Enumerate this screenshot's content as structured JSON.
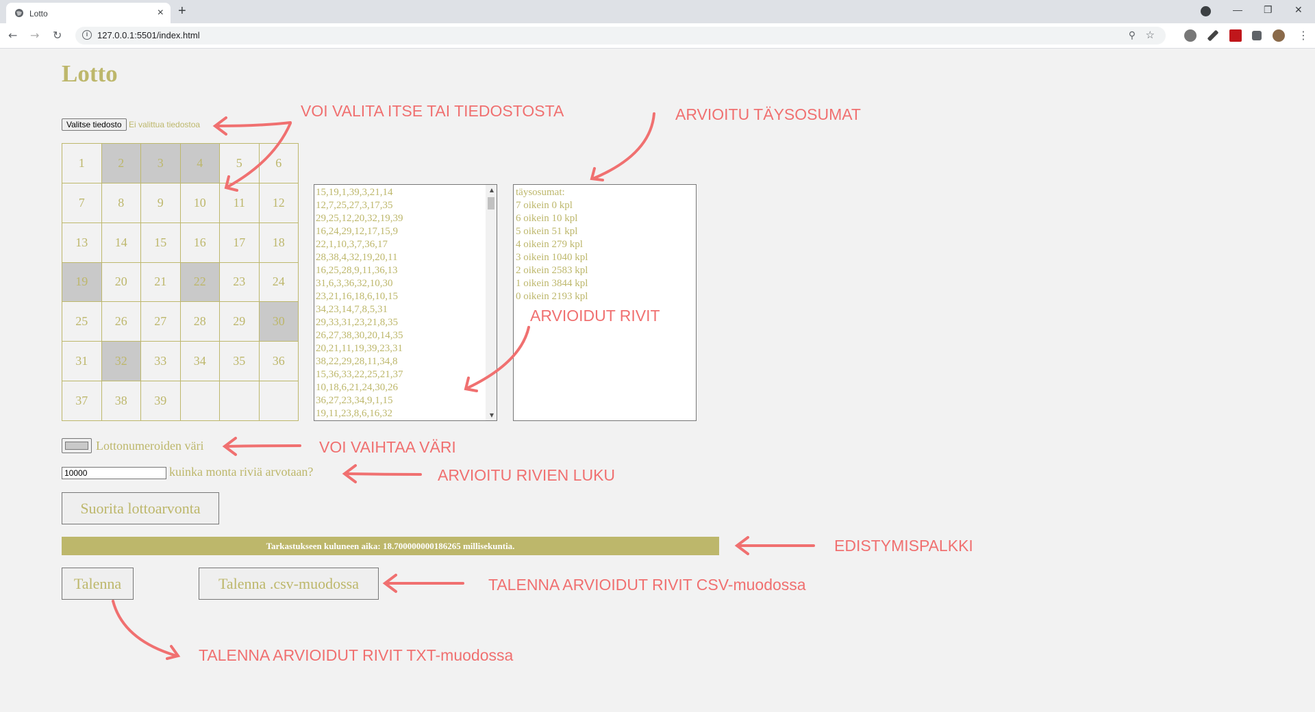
{
  "browser": {
    "tab_title": "Lotto",
    "url": "127.0.0.1:5501/index.html"
  },
  "page": {
    "title": "Lotto",
    "file_button": "Valitse tiedosto",
    "file_status": "Ei valittua tiedostoa",
    "numbers": [
      1,
      2,
      3,
      4,
      5,
      6,
      7,
      8,
      9,
      10,
      11,
      12,
      13,
      14,
      15,
      16,
      17,
      18,
      19,
      20,
      21,
      22,
      23,
      24,
      25,
      26,
      27,
      28,
      29,
      30,
      31,
      32,
      33,
      34,
      35,
      36,
      37,
      38,
      39
    ],
    "selected_numbers": [
      2,
      3,
      4,
      19,
      22,
      30,
      32
    ],
    "rows": [
      "15,19,1,39,3,21,14",
      "12,7,25,27,3,17,35",
      "29,25,12,20,32,19,39",
      "16,24,29,12,17,15,9",
      "22,1,10,3,7,36,17",
      "28,38,4,32,19,20,11",
      "16,25,28,9,11,36,13",
      "31,6,3,36,32,10,30",
      "23,21,16,18,6,10,15",
      "34,23,14,7,8,5,31",
      "29,33,31,23,21,8,35",
      "26,27,38,30,20,14,35",
      "20,21,11,19,39,23,31",
      "38,22,29,28,11,34,8",
      "15,36,33,22,25,21,37",
      "10,18,6,21,24,30,26",
      "36,27,23,34,9,1,15",
      "19,11,23,8,6,16,32"
    ],
    "results_title": "täysosumat:",
    "results": [
      "7 oikein 0 kpl",
      "6 oikein 10 kpl",
      "5 oikein 51 kpl",
      "4 oikein 279 kpl",
      "3 oikein 1040 kpl",
      "2 oikein 2583 kpl",
      "1 oikein 3844 kpl",
      "0 oikein 2193 kpl"
    ],
    "color_label": "Lottonumeroiden väri",
    "color_value": "#c9c9c9",
    "count_value": "10000",
    "count_label": "kuinka monta riviä arvotaan?",
    "run_button": "Suorita lottoarvonta",
    "progress_text": "Tarkastukseen kuluneen aika: 18.700000000186265 millisekuntia.",
    "progress_fraction": 1,
    "save_button": "Talenna",
    "csv_button": "Talenna .csv-muodossa"
  },
  "annotations": {
    "file": "VOI VALITA ITSE TAI TIEDOSTOSTA",
    "hits": "ARVIOITU TÄYSOSUMAT",
    "rows": "ARVIOIDUT RIVIT",
    "color": "VOI VAIHTAA VÄRI",
    "count": "ARVIOITU RIVIEN LUKU",
    "progress": "EDISTYMISPALKKI",
    "csv": "TALENNA ARVIOIDUT RIVIT CSV-muodossa",
    "txt": "TALENNA ARVIOIDUT RIVIT TXT-muodossa"
  },
  "colors": {
    "accent": "#bdb76b",
    "selected_cell": "#c9c9c9",
    "annotation": "#f07070"
  }
}
